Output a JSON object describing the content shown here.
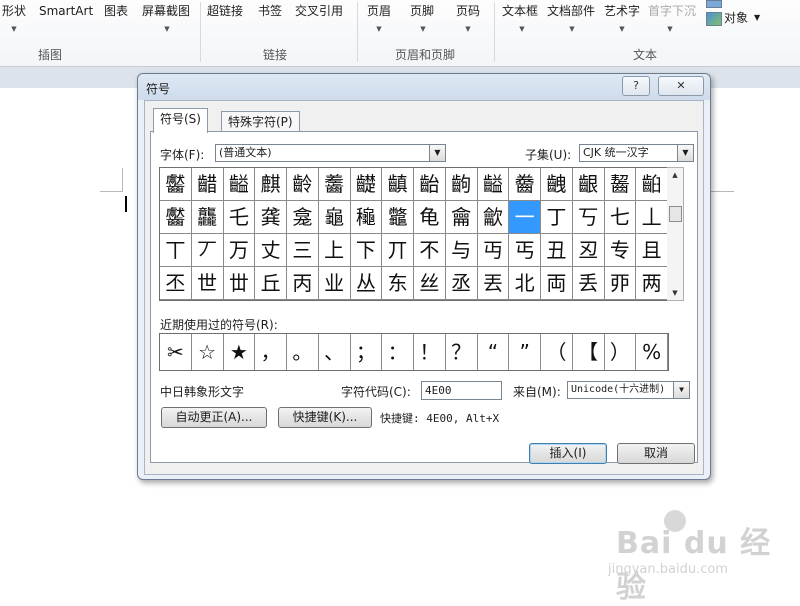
{
  "ribbon": {
    "buttons": [
      "形状",
      "SmartArt",
      "图表",
      "屏幕截图",
      "超链接",
      "书签",
      "交叉引用",
      "页眉",
      "页脚",
      "页码",
      "文本框",
      "文档部件",
      "艺术字",
      "首字下沉",
      "对象"
    ],
    "groups": [
      "插图",
      "链接",
      "页眉和页脚",
      "文本"
    ]
  },
  "dialog": {
    "title": "符号",
    "help_glyph": "?",
    "close_glyph": "✕",
    "tabs": [
      "符号(S)",
      "特殊字符(P)"
    ],
    "font_label": "字体(F):",
    "font_value": "(普通文本)",
    "subset_label": "子集(U):",
    "subset_value": "CJK 统一汉字",
    "grid_rows": [
      [
        "齾",
        "齰",
        "齸",
        "齻",
        "齼",
        "齽",
        "齾",
        "齿",
        "龀",
        "龁",
        "龂",
        "龃",
        "龄",
        "龅",
        "龆"
      ],
      [
        "齾",
        "龘",
        "乇",
        "龚",
        "龛",
        "龜",
        "龝",
        "龞",
        "龟",
        "龠",
        "龡",
        "一",
        "丁",
        "丂",
        "七",
        "丄"
      ],
      [
        "丅",
        "丆",
        "万",
        "丈",
        "三",
        "上",
        "下",
        "丌",
        "不",
        "与",
        "丏",
        "丐",
        "丑",
        "丒",
        "专",
        "且"
      ],
      [
        "丕",
        "世",
        "丗",
        "丘",
        "丙",
        "业",
        "丛",
        "东",
        "丝",
        "丞",
        "丟",
        "丠",
        "両",
        "丢",
        "丣",
        "两"
      ]
    ],
    "grid_rows_display": [
      [
        "齾",
        "齰",
        "齸",
        "麒",
        "齡",
        "齹",
        "齼",
        "齻",
        "齝",
        "齣",
        "齸",
        "齤",
        "齥",
        "齦",
        "齧",
        "齨"
      ],
      [
        "齾",
        "龘",
        "乇",
        "龚",
        "龛",
        "龜",
        "龝",
        "龞",
        "龟",
        "龠",
        "龡",
        "一",
        "丁",
        "丂",
        "七",
        "丄"
      ],
      [
        "丅",
        "丆",
        "万",
        "丈",
        "三",
        "上",
        "下",
        "丌",
        "不",
        "与",
        "丏",
        "丐",
        "丑",
        "丒",
        "专",
        "且"
      ],
      [
        "丕",
        "世",
        "丗",
        "丘",
        "丙",
        "业",
        "丛",
        "东",
        "丝",
        "丞",
        "丟",
        "北",
        "両",
        "丢",
        "丣",
        "两"
      ]
    ],
    "selected_row": 1,
    "selected_col": 11,
    "recent_label": "近期使用过的符号(R):",
    "recent_symbols": [
      "✂",
      "☆",
      "★",
      "，",
      "。",
      "、",
      "；",
      "：",
      "！",
      "？",
      "“",
      "”",
      "（",
      "【",
      "）",
      "%"
    ],
    "char_name": "中日韩象形文字",
    "char_code_label": "字符代码(C):",
    "char_code_value": "4E00",
    "from_label": "来自(M):",
    "from_value": "Unicode(十六进制)",
    "autocorrect_button": "自动更正(A)...",
    "shortcut_button": "快捷键(K)...",
    "shortcut_text": "快捷键: 4E00, Alt+X",
    "insert_button": "插入(I)",
    "cancel_button": "取消"
  },
  "watermark": {
    "logo": "Bai du 经验",
    "url": "jingyan.baidu.com"
  }
}
